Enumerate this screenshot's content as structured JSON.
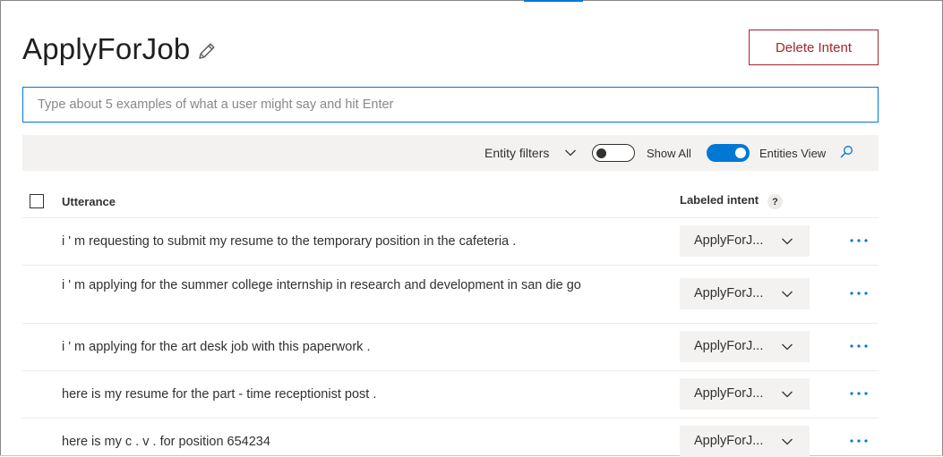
{
  "intent": {
    "title": "ApplyForJob",
    "delete_label": "Delete Intent"
  },
  "input": {
    "placeholder": "Type about 5 examples of what a user might say and hit Enter",
    "value": ""
  },
  "toolbar": {
    "entity_filters_label": "Entity filters",
    "show_all_label": "Show All",
    "show_all_on": false,
    "entities_view_label": "Entities View",
    "entities_view_on": true
  },
  "table": {
    "col_utterance": "Utterance",
    "col_labeled_intent": "Labeled intent",
    "help_glyph": "?",
    "rows": [
      {
        "utterance": "i ' m requesting to submit my resume to the temporary position in the cafeteria .",
        "intent": "ApplyForJ..."
      },
      {
        "utterance": "i ' m applying for the summer college internship in research and development in san die go",
        "intent": "ApplyForJ..."
      },
      {
        "utterance": "i ' m applying for the art desk job with this paperwork .",
        "intent": "ApplyForJ..."
      },
      {
        "utterance": "here is my resume for the part - time receptionist post .",
        "intent": "ApplyForJ..."
      },
      {
        "utterance": "here is my c . v . for position 654234",
        "intent": "ApplyForJ..."
      }
    ]
  },
  "colors": {
    "accent": "#0078d4",
    "danger": "#a4262c",
    "toolbar_bg": "#f3f2f1"
  },
  "icons": [
    "pencil-icon",
    "chevron-down-icon",
    "search-icon",
    "more-icon",
    "help-icon"
  ]
}
